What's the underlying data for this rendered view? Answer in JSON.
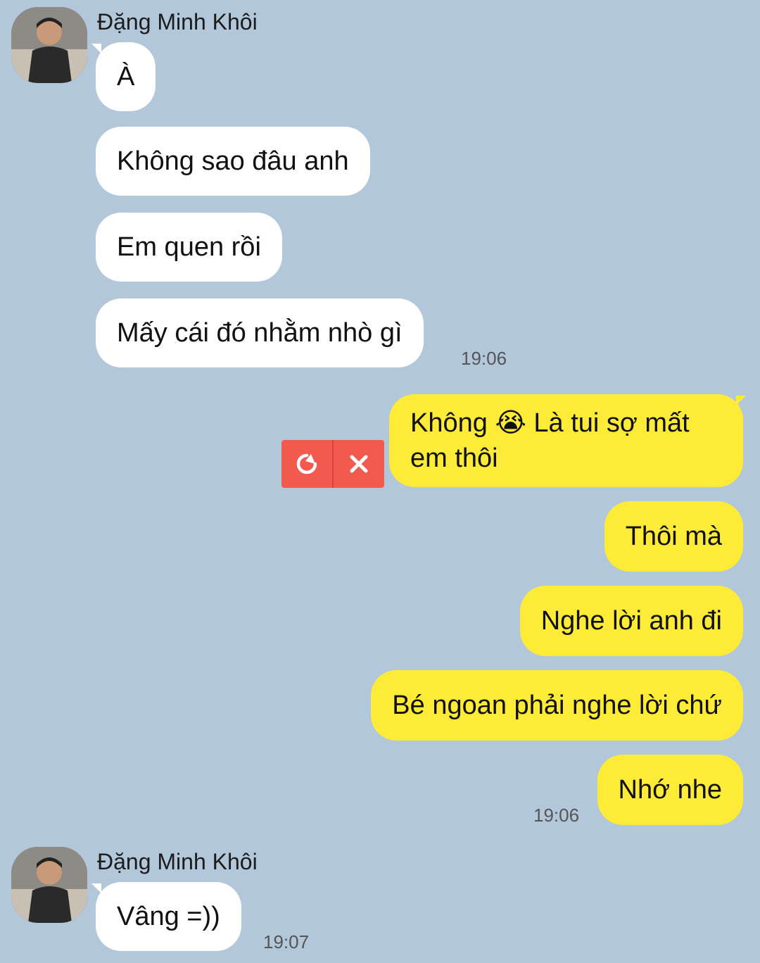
{
  "conversation": {
    "group1": {
      "sender": "Đặng Minh Khôi",
      "messages": [
        "À",
        "Không sao đâu anh",
        "Em quen rồi",
        "Mấy cái đó nhằm nhò gì"
      ],
      "time": "19:06"
    },
    "outgoing": {
      "failed_message_line1": "Không 😭 Là tui sợ mất",
      "failed_message_line2": "em thôi",
      "messages": [
        "Thôi mà",
        "Nghe lời anh đi",
        "Bé ngoan phải nghe lời chứ",
        "Nhớ nhe"
      ],
      "time": "19:06",
      "retry_icon": "retry-icon",
      "delete_icon": "close-icon"
    },
    "group2": {
      "sender": "Đặng Minh Khôi",
      "messages": [
        "Vâng =))"
      ],
      "time": "19:07"
    }
  },
  "colors": {
    "background": "#b2c7da",
    "incoming_bubble": "#ffffff",
    "outgoing_bubble": "#fdeb37",
    "fail_button": "#f25a4f"
  }
}
